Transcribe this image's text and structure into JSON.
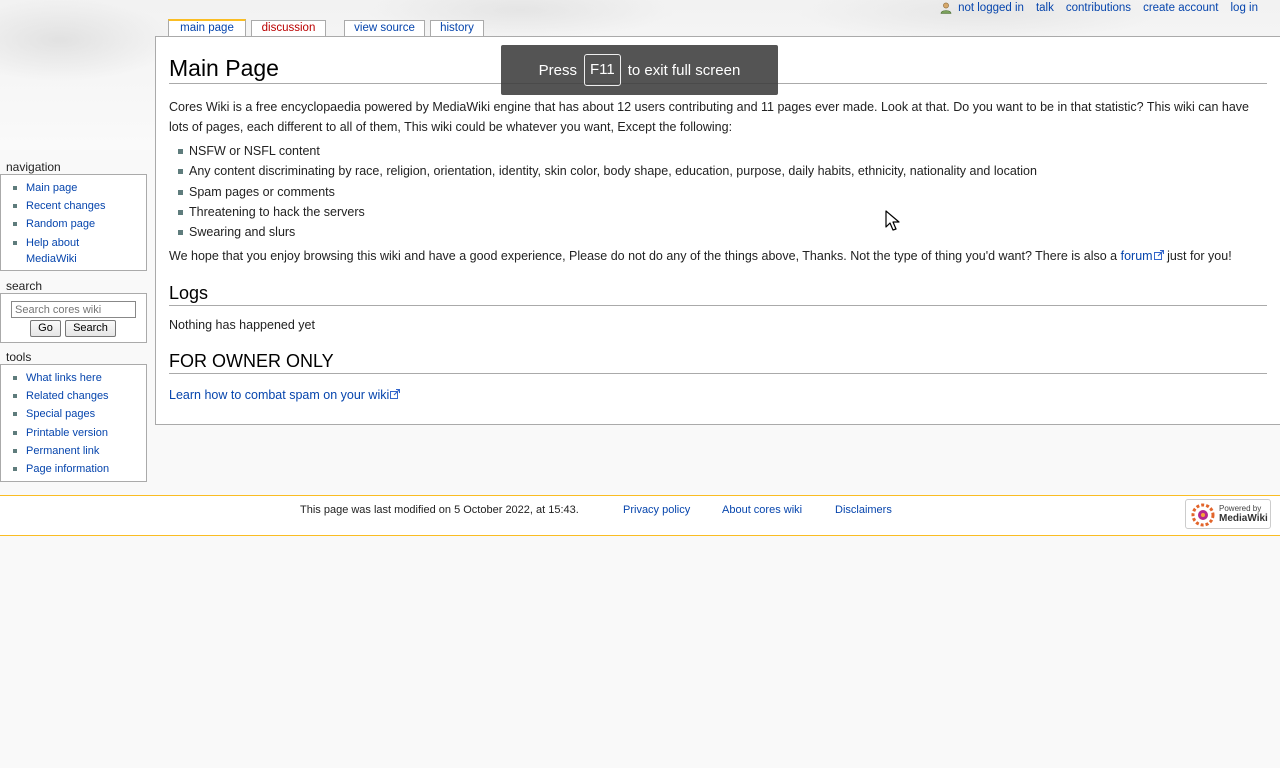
{
  "personal_tools": {
    "items": [
      "not logged in",
      "talk",
      "contributions",
      "create account",
      "log in"
    ]
  },
  "tabs": [
    "main page",
    "discussion",
    "view source",
    "history"
  ],
  "fullscreen_notice": {
    "prefix": "Press",
    "key": "F11",
    "suffix": "to exit full screen"
  },
  "page": {
    "title": "Main Page",
    "intro": "Cores Wiki is a free encyclopaedia powered by MediaWiki engine that has about 12 users contributing and 11 pages ever made. Look at that. Do you want to be in that statistic? This wiki can have lots of pages, each different to all of them, This wiki could be whatever you want, Except the following:",
    "rules": [
      "NSFW or NSFL content",
      "Any content discriminating by race, religion, orientation, identity, skin color, body shape, education, purpose, daily habits, ethnicity, nationality and location",
      "Spam pages or comments",
      "Threatening to hack the servers",
      "Swearing and slurs"
    ],
    "closing_before": "We hope that you enjoy browsing this wiki and have a good experience, Please do not do any of the things above, Thanks. Not the type of thing you'd want? There is also a",
    "closing_link": "forum",
    "closing_after": "just for you!",
    "logs_heading": "Logs",
    "logs_text": "Nothing has happened yet",
    "owner_heading": "FOR OWNER ONLY",
    "owner_link": "Learn how to combat spam on your wiki"
  },
  "sidebar": {
    "navigation_title": "navigation",
    "navigation": [
      "Main page",
      "Recent changes",
      "Random page",
      "Help about MediaWiki"
    ],
    "search_title": "search",
    "search_placeholder": "Search cores wiki",
    "go_label": "Go",
    "search_label": "Search",
    "tools_title": "tools",
    "tools": [
      "What links here",
      "Related changes",
      "Special pages",
      "Printable version",
      "Permanent link",
      "Page information"
    ]
  },
  "footer": {
    "last_modified": "This page was last modified on 5 October 2022, at 15:43.",
    "privacy": "Privacy policy",
    "about": "About cores wiki",
    "disclaimers": "Disclaimers",
    "powered_small": "Powered by",
    "powered_big": "MediaWiki"
  },
  "colors": {
    "link": "#0645ad",
    "new_link": "#ba0000",
    "accent": "#fabd23"
  }
}
